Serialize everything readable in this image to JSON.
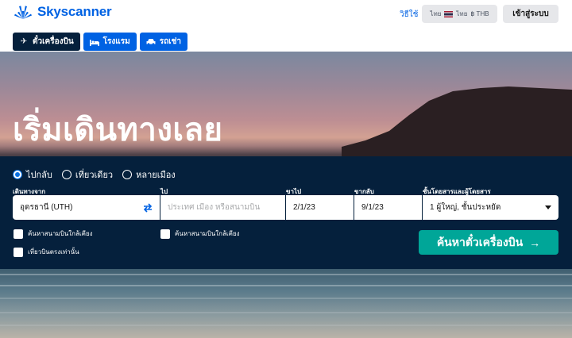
{
  "brand": {
    "name": "Skyscanner",
    "color": "#0062e3"
  },
  "header": {
    "help_label": "วิธีใช้",
    "locale_label": "ไทย",
    "region_label": "ไทย",
    "currency_label": "฿ THB",
    "login_label": "เข้าสู่ระบบ"
  },
  "tabs": [
    {
      "label": "ตั๋วเครื่องบิน",
      "icon": "airplane-icon",
      "active": true
    },
    {
      "label": "โรงแรม",
      "icon": "bed-icon",
      "active": false
    },
    {
      "label": "รถเช่า",
      "icon": "car-icon",
      "active": false
    }
  ],
  "hero": {
    "title": "เริ่มเดินทางเลย"
  },
  "search": {
    "trip_types": [
      {
        "label": "ไปกลับ",
        "checked": true
      },
      {
        "label": "เที่ยวเดียว",
        "checked": false
      },
      {
        "label": "หลายเมือง",
        "checked": false
      }
    ],
    "origin_label": "เดินทางจาก",
    "origin_value": "อุดรธานี (UTH)",
    "dest_label": "ไป",
    "dest_placeholder": "ประเทศ เมือง หรือสนามบิน",
    "depart_label": "ขาไป",
    "depart_value": "2/1/23",
    "return_label": "ขากลับ",
    "return_value": "9/1/23",
    "travellers_label": "ชั้นโดยสารและผู้โดยสาร",
    "travellers_value": "1 ผู้ใหญ่, ชั้นประหยัด",
    "nearby_origin_label": "ค้นหาสนามบินใกล้เคียง",
    "nearby_dest_label": "ค้นหาสนามบินใกล้เคียง",
    "direct_only_label": "เที่ยวบินตรงเท่านั้น",
    "submit_label": "ค้นหาตั๋วเครื่องบิน",
    "submit_color": "#00a698"
  }
}
